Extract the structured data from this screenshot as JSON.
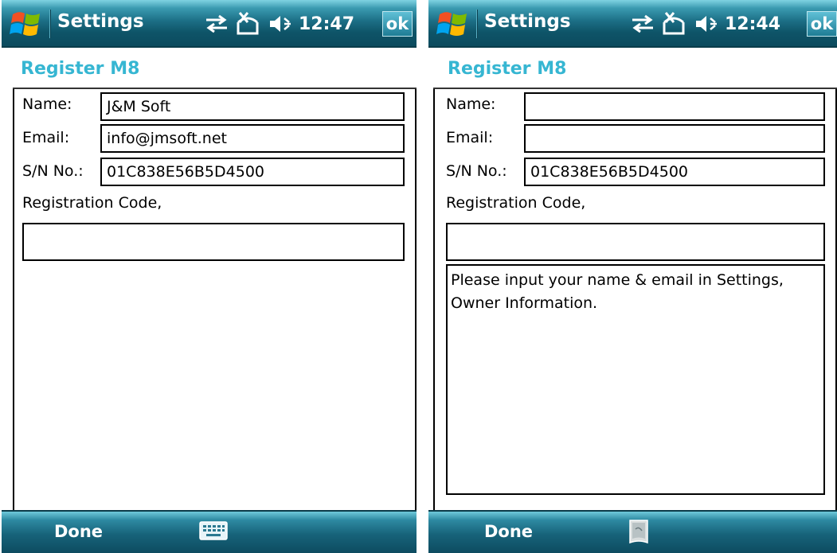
{
  "left": {
    "titlebar": {
      "title": "Settings",
      "clock": "12:47",
      "ok_label": "ok"
    },
    "page_title": "Register M8",
    "form": {
      "name_label": "Name:",
      "name_value": "J&M Soft",
      "email_label": "Email:",
      "email_value": "info@jmsoft.net",
      "sn_label": "S/N No.:",
      "sn_value": "01C838E56B5D4500",
      "reg_label": "Registration Code,",
      "reg_value": ""
    },
    "softbar": {
      "left_label": "Done",
      "input_icon": "keyboard-icon"
    }
  },
  "right": {
    "titlebar": {
      "title": "Settings",
      "clock": "12:44",
      "ok_label": "ok"
    },
    "page_title": "Register M8",
    "form": {
      "name_label": "Name:",
      "name_value": "",
      "email_label": "Email:",
      "email_value": "",
      "sn_label": "S/N No.:",
      "sn_value": "01C838E56B5D4500",
      "reg_label": "Registration Code,",
      "reg_value": "",
      "message_line1": "Please input your name & email in Settings,",
      "message_line2": "Owner Information."
    },
    "softbar": {
      "left_label": "Done",
      "input_icon": "handwriting-pad-icon"
    }
  },
  "colors": {
    "accent": "#36b6d2",
    "titlebar": "#1c6f86",
    "text": "#000000"
  }
}
